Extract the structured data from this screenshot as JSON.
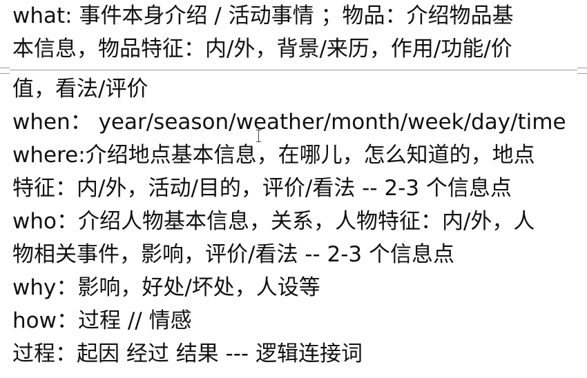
{
  "document": {
    "lines": [
      "what: 事件本身介绍  /  活动事情  ；物品：介绍物品基",
      "本信息，物品特征：内/外，背景/来历，作用/功能/价",
      "值，看法/评价",
      "when：  year/season/weather/month/week/day/time",
      "where:介绍地点基本信息，在哪儿，怎么知道的，地点",
      "特征：内/外，活动/目的，评价/看法  -- 2-3 个信息点",
      "who：介绍人物基本信息，关系，人物特征：内/外，人",
      "物相关事件，影响，评价/看法  -- 2-3 个信息点",
      "why：影响，好处/坏处，人设等",
      "how：过程  //  情感",
      "过程：起因  经过  结果  ---  逻辑连接词"
    ]
  }
}
